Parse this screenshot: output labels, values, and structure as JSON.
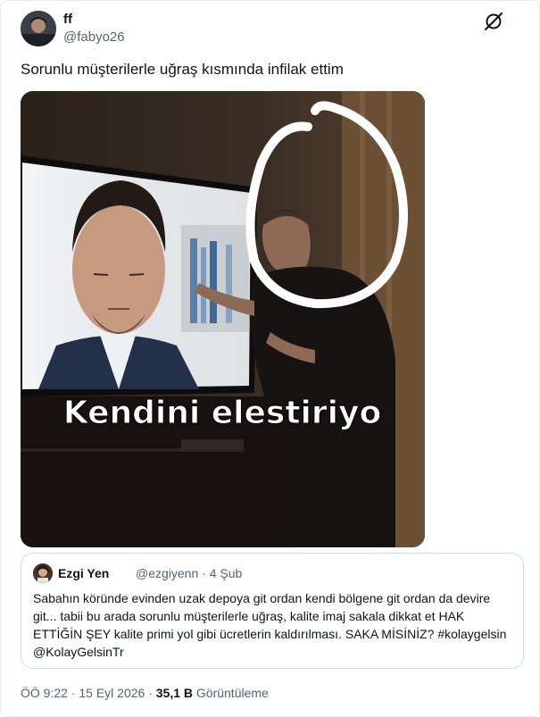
{
  "tweet": {
    "author_name": "ff",
    "author_handle": "@fabyo26",
    "text": "Sorunlu müşterilerle uğraş kısmında infilak ettim",
    "image_caption": "Kendini elestiriyo",
    "timestamp": "ÖÖ 9:22 · 15 Eyl 2026 · ",
    "views_count": "35,1 B",
    "views_label": " Görüntüleme"
  },
  "quoted_tweet": {
    "author_name": "Ezgi Yen",
    "author_handle": "@ezgiyenn",
    "date": "· 4 Şub",
    "text": "Sabahın köründe evinden uzak depoya git ordan kendi bölgene git ordan da devire git... tabii bu arada sorunlu müşterilerle uğraş, kalite imaj sakala dikkat et HAK ETTİĞİN ŞEY kalite primi yol gibi ücretlerin kaldırılması. SAKA MİSİNİZ? #kolaygelsin @KolayGelsinTr"
  },
  "icons": {
    "top_right": "grok-logo-icon"
  }
}
